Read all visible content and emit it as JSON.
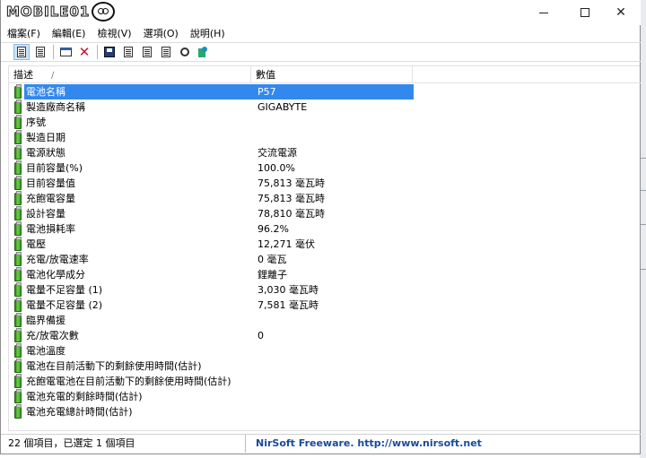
{
  "window": {
    "logo_text": "MOBILE01",
    "controls": {
      "minimize": "minimize",
      "maximize": "maximize",
      "close": "✕"
    }
  },
  "menu": [
    {
      "label": "檔案(F)"
    },
    {
      "label": "編輯(E)"
    },
    {
      "label": "檢視(V)"
    },
    {
      "label": "選項(O)"
    },
    {
      "label": "說明(H)"
    }
  ],
  "toolbar": {
    "icons": [
      "html-report-icon",
      "list-view-icon",
      "properties-icon",
      "delete-icon",
      "save-icon",
      "refresh-icon",
      "copy-icon",
      "copy-selected-icon",
      "find-icon",
      "exit-icon"
    ]
  },
  "list": {
    "columns": {
      "description": "描述",
      "value": "數值"
    },
    "selected_row": 0,
    "rows": [
      {
        "desc": "電池名稱",
        "value": "P57"
      },
      {
        "desc": "製造廠商名稱",
        "value": "GIGABYTE"
      },
      {
        "desc": "序號",
        "value": ""
      },
      {
        "desc": "製造日期",
        "value": ""
      },
      {
        "desc": "電源狀態",
        "value": "交流電源"
      },
      {
        "desc": "目前容量(%)",
        "value": "100.0%"
      },
      {
        "desc": "目前容量值",
        "value": "75,813 毫瓦時"
      },
      {
        "desc": "充飽電容量",
        "value": "75,813 毫瓦時"
      },
      {
        "desc": "設計容量",
        "value": "78,810 毫瓦時"
      },
      {
        "desc": "電池損耗率",
        "value": "96.2%"
      },
      {
        "desc": "電壓",
        "value": "12,271 毫伏"
      },
      {
        "desc": "充電/放電速率",
        "value": "0 毫瓦"
      },
      {
        "desc": "電池化學成分",
        "value": "鋰離子"
      },
      {
        "desc": "電量不足容量 (1)",
        "value": "3,030 毫瓦時"
      },
      {
        "desc": "電量不足容量 (2)",
        "value": "7,581 毫瓦時"
      },
      {
        "desc": "臨界備援",
        "value": ""
      },
      {
        "desc": "充/放電次數",
        "value": "0"
      },
      {
        "desc": "電池溫度",
        "value": ""
      },
      {
        "desc": "電池在目前活動下的剩餘使用時間(估計)",
        "value": ""
      },
      {
        "desc": "充飽電電池在目前活動下的剩餘使用時間(估計)",
        "value": ""
      },
      {
        "desc": "電池充電的剩餘時間(估計)",
        "value": ""
      },
      {
        "desc": "電池充電總計時間(估計)",
        "value": ""
      }
    ]
  },
  "status": {
    "count": "22 個項目，已選定 1 個項目",
    "credit": "NirSoft Freeware.  http://www.nirsoft.net"
  },
  "colors": {
    "selection": "#3388ee",
    "battery": "#4caf2a",
    "credit_text": "#1a4a9a"
  }
}
